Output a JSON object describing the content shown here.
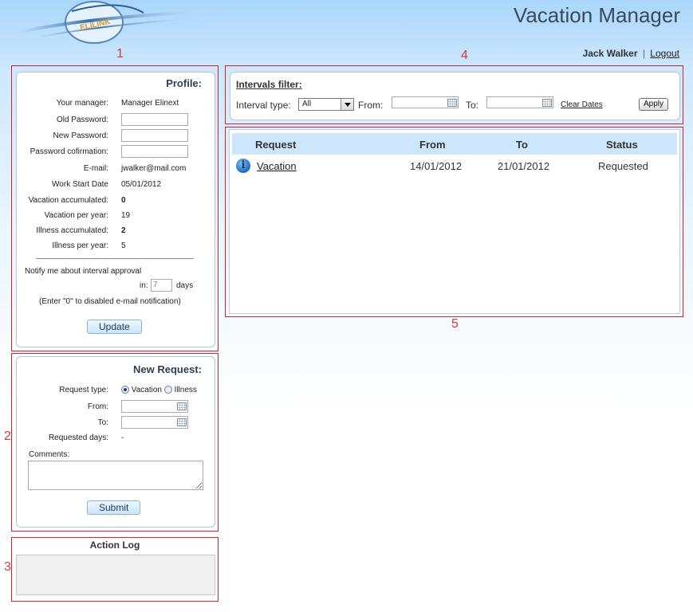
{
  "header": {
    "logo_text": "ELILINK",
    "app_title": "Vacation Manager",
    "user_name": "Jack Walker",
    "separator": "|",
    "logout_label": "Logout"
  },
  "annotations": [
    "1",
    "2",
    "3",
    "4",
    "5"
  ],
  "profile": {
    "title": "Profile:",
    "manager_label": "Your manager:",
    "manager_value": "Manager Elinext",
    "old_password_label": "Old Password:",
    "new_password_label": "New Password:",
    "password_confirm_label": "Password cofirmation:",
    "email_label": "E-mail:",
    "email_value": "jwalker@mail.com",
    "work_start_label": "Work Start Date",
    "work_start_value": "05/01/2012",
    "vacation_accumulated_label": "Vacation accumulated:",
    "vacation_accumulated_value": "0",
    "vacation_per_year_label": "Vacation per year:",
    "vacation_per_year_value": "19",
    "illness_accumulated_label": "Illness accumulated:",
    "illness_accumulated_value": "2",
    "illness_per_year_label": "Illness per year:",
    "illness_per_year_value": "5",
    "notify_label": "Notify me about interval approval",
    "in_label": "in:",
    "days_value": "7",
    "days_label": "days",
    "hint": "(Enter \"0\" to disabled e-mail notification)",
    "update_label": "Update"
  },
  "new_request": {
    "title": "New Request:",
    "type_label": "Request type:",
    "vacation_option": "Vacation",
    "illness_option": "Illness",
    "selected_type": "Vacation",
    "from_label": "From:",
    "to_label": "To:",
    "requested_days_label": "Requested days:",
    "requested_days_value": "-",
    "comments_label": "Comments:",
    "submit_label": "Submit"
  },
  "action_log": {
    "title": "Action Log"
  },
  "filter": {
    "title": "Intervals filter:",
    "interval_type_label": "Interval type:",
    "interval_type_value": "All",
    "from_label": "From:",
    "to_label": "To:",
    "clear_dates_label": "Clear Dates",
    "apply_label": "Apply"
  },
  "grid": {
    "columns": [
      "Request",
      "From",
      "To",
      "Status"
    ],
    "rows": [
      {
        "request": "Vacation",
        "from": "14/01/2012",
        "to": "21/01/2012",
        "status": "Requested",
        "icon": "info-icon"
      }
    ]
  },
  "colors": {
    "accent": "#cce6fb",
    "frame_red": "#c9252f",
    "title_text": "#3a4a5a"
  }
}
